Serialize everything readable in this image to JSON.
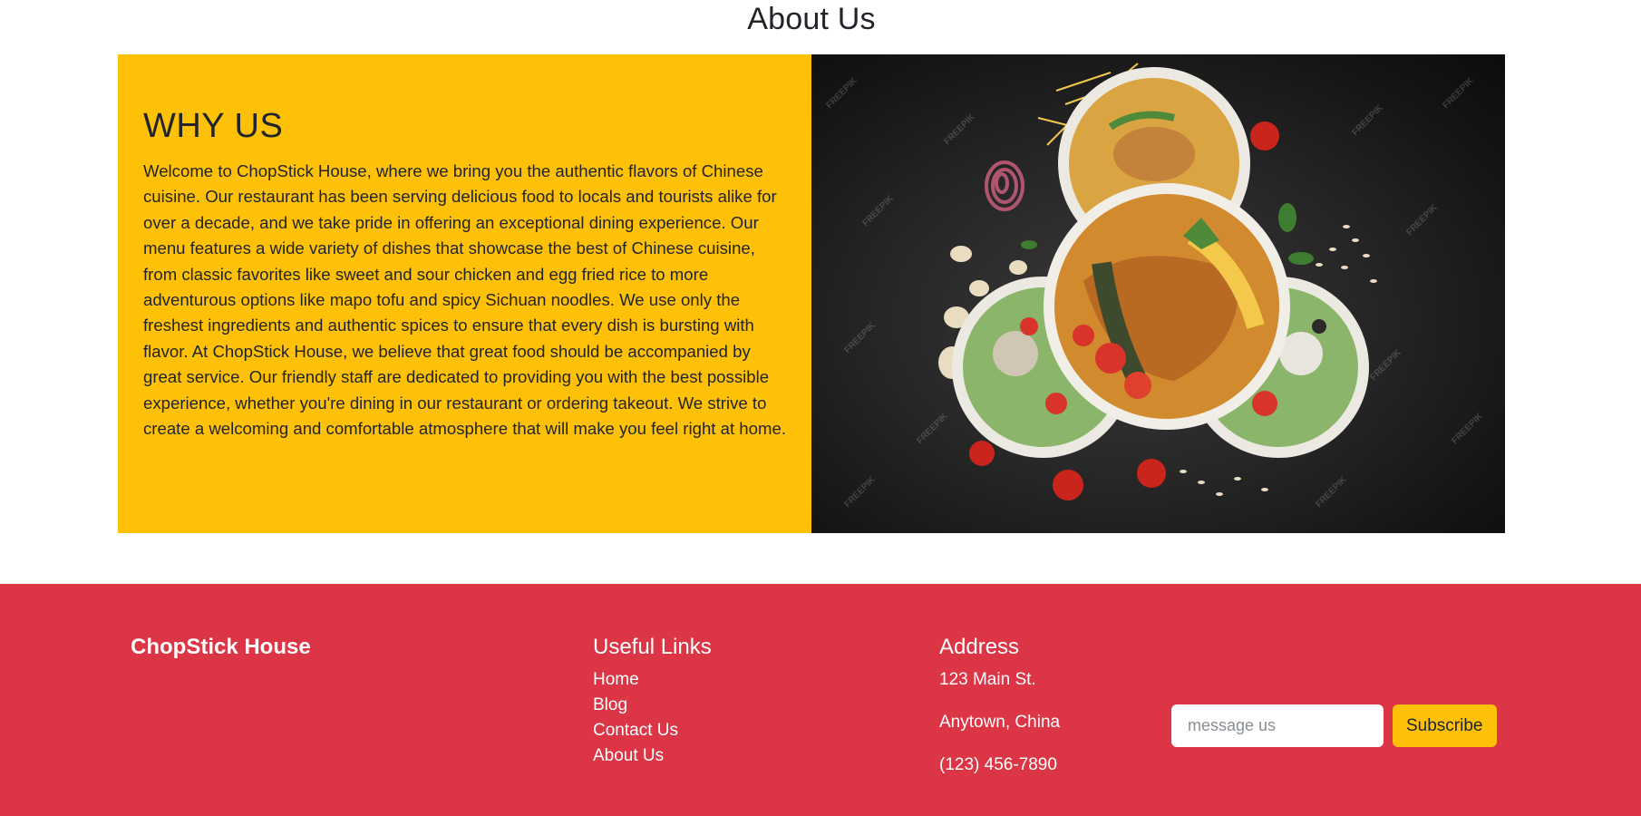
{
  "about": {
    "title": "About Us",
    "why_heading": "WHY US",
    "why_text": "Welcome to ChopStick House, where we bring you the authentic flavors of Chinese cuisine. Our restaurant has been serving delicious food to locals and tourists alike for over a decade, and we take pride in offering an exceptional dining experience. Our menu features a wide variety of dishes that showcase the best of Chinese cuisine, from classic favorites like sweet and sour chicken and egg fried rice to more adventurous options like mapo tofu and spicy Sichuan noodles. We use only the freshest ingredients and authentic spices to ensure that every dish is bursting with flavor. At ChopStick House, we believe that great food should be accompanied by great service. Our friendly staff are dedicated to providing you with the best possible experience, whether you're dining in our restaurant or ordering takeout. We strive to create a welcoming and comfortable atmosphere that will make you feel right at home.",
    "watermark": "FREEPIK"
  },
  "footer": {
    "brand": "ChopStick House",
    "links_heading": "Useful Links",
    "links": [
      {
        "label": "Home"
      },
      {
        "label": "Blog"
      },
      {
        "label": "Contact Us"
      },
      {
        "label": "About Us"
      }
    ],
    "address_heading": "Address",
    "address_lines": [
      "123 Main St.",
      "Anytown, China",
      "(123) 456-7890"
    ],
    "message_placeholder": "message us",
    "subscribe_label": "Subscribe"
  },
  "colors": {
    "accent_yellow": "#ffc107",
    "footer_red": "#dc3545",
    "text_dark": "#212529"
  }
}
